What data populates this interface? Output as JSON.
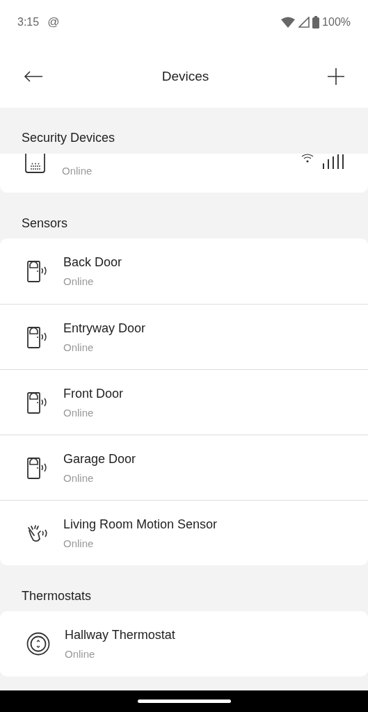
{
  "status_bar": {
    "time": "3:15",
    "notification": "@",
    "battery": "100%"
  },
  "app_bar": {
    "title": "Devices"
  },
  "sections": [
    {
      "title": "Security Devices",
      "cut_top": true,
      "devices": [
        {
          "kind": "hub",
          "status": "Online"
        }
      ]
    },
    {
      "title": "Sensors",
      "cut_top": false,
      "devices": [
        {
          "kind": "contact",
          "name": "Back Door",
          "status": "Online"
        },
        {
          "kind": "contact",
          "name": "Entryway Door",
          "status": "Online"
        },
        {
          "kind": "contact",
          "name": "Front Door",
          "status": "Online"
        },
        {
          "kind": "contact",
          "name": "Garage Door",
          "status": "Online"
        },
        {
          "kind": "motion",
          "name": "Living Room Motion Sensor",
          "status": "Online"
        }
      ]
    },
    {
      "title": "Thermostats",
      "cut_top": false,
      "devices": [
        {
          "kind": "thermostat",
          "name": "Hallway Thermostat",
          "status": "Online"
        }
      ]
    }
  ]
}
